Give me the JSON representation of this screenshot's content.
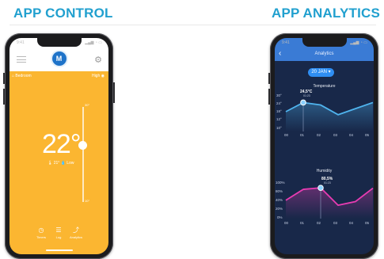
{
  "left_heading": "APP CONTROL",
  "right_heading": "APP ANALYTICS",
  "control": {
    "status_time": "9:41",
    "status_icons": "▂▄▆ ◔ ▭",
    "brand_mark": "M",
    "room": "⌂ Bedroom",
    "mode": "High ◉",
    "temperature": "22°",
    "info": "🌡 21° 💧 Low",
    "slider_max": "30°",
    "slider_min": "10°",
    "slider_level": 0.6,
    "nav": [
      {
        "icon": "◷",
        "label": "Timers"
      },
      {
        "icon": "☰",
        "label": "Log"
      },
      {
        "icon": "⤴",
        "label": "Analytics"
      }
    ]
  },
  "analytics": {
    "status_time": "9:41",
    "status_icons": "▂▄▆ ◔ ▭",
    "title": "Analytics",
    "date": "20 JAN ▾",
    "charts": [
      {
        "title": "Temperature",
        "callout_value": "24,5°C",
        "callout_time": "01:23",
        "yticks": [
          "30°",
          "24°",
          "18°",
          "12°",
          "10°"
        ],
        "xticks": [
          "00",
          "01",
          "02",
          "03",
          "04",
          "05"
        ],
        "color": "#4fb4ee"
      },
      {
        "title": "Humidity",
        "callout_value": "80,5%",
        "callout_time": "01:23",
        "yticks": [
          "100%",
          "80%",
          "40%",
          "20%",
          "0%"
        ],
        "xticks": [
          "00",
          "01",
          "02",
          "03",
          "04",
          "05"
        ],
        "color": "#e83cb2"
      }
    ]
  },
  "chart_data": [
    {
      "type": "area",
      "title": "Temperature",
      "x": [
        "00",
        "01",
        "02",
        "03",
        "04",
        "05"
      ],
      "series": [
        {
          "values": [
            21.5,
            24.5,
            23.7,
            20.5,
            22.5,
            24.5
          ]
        }
      ],
      "highlight": {
        "x": "01",
        "label": "24,5°C",
        "time": "01:23"
      },
      "y_tick_labels": [
        "30°",
        "24°",
        "18°",
        "12°",
        "10°"
      ]
    },
    {
      "type": "area",
      "title": "Humidity",
      "x": [
        "00",
        "01",
        "02",
        "03",
        "04",
        "05"
      ],
      "series": [
        {
          "values": [
            60,
            78,
            80.5,
            52,
            58,
            80
          ]
        }
      ],
      "highlight": {
        "x": "02",
        "label": "80,5%",
        "time": "01:23"
      },
      "y_tick_labels": [
        "100%",
        "80%",
        "40%",
        "20%",
        "0%"
      ]
    }
  ]
}
